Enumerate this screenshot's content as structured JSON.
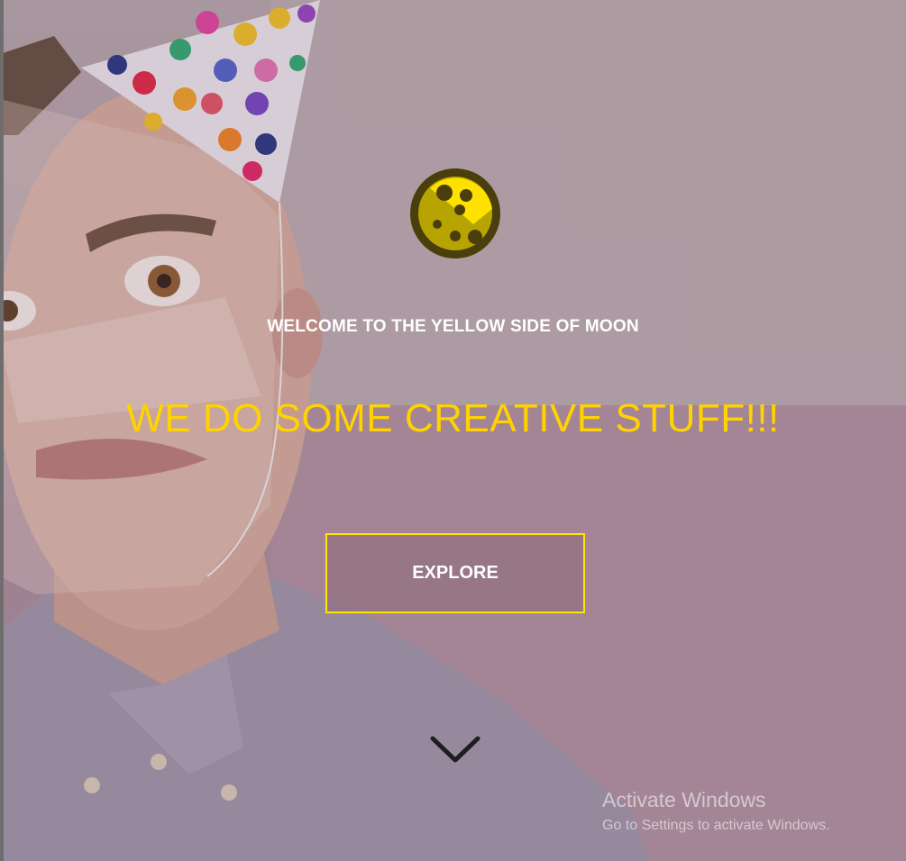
{
  "hero": {
    "welcome_text": "WELCOME TO THE YELLOW SIDE OF MOON",
    "headline": "WE DO SOME CREATIVE STUFF!!!",
    "explore_label": "EXPLORE",
    "logo_icon": "moon-logo-icon",
    "scroll_icon": "chevron-down-icon"
  },
  "colors": {
    "accent_yellow": "#ffd200",
    "button_border": "#ffe600",
    "text_white": "#ffffff"
  },
  "watermark": {
    "title": "Activate Windows",
    "subtitle": "Go to Settings to activate Windows."
  }
}
